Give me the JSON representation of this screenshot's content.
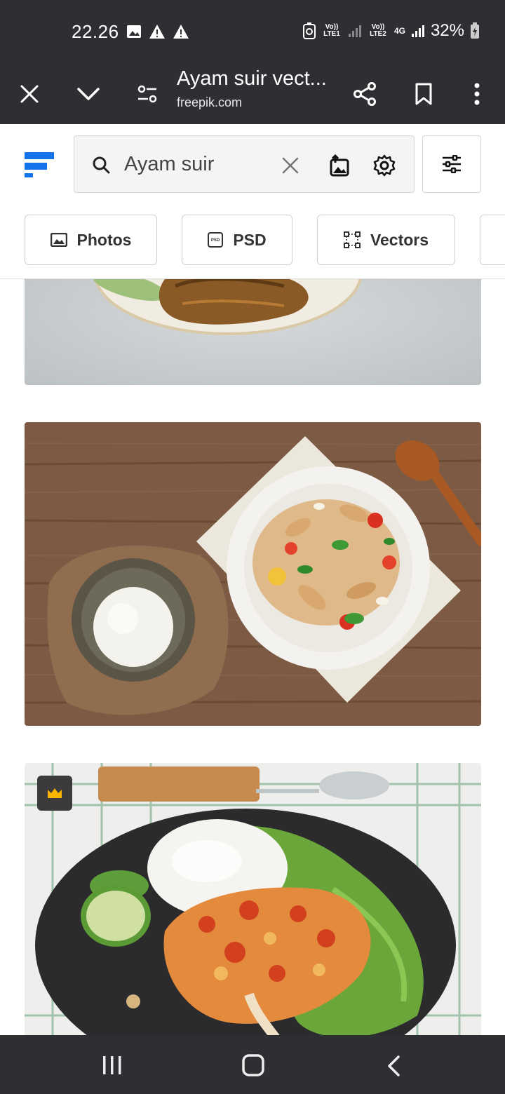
{
  "status_bar": {
    "time": "22.26",
    "network1": "Vo)) LTE1",
    "network2": "Vo)) LTE2",
    "network_type": "4G",
    "battery": "32%"
  },
  "browser": {
    "page_title": "Ayam suir vect...",
    "url": "freepik.com"
  },
  "search": {
    "query": "Ayam suir"
  },
  "filter_chips": [
    {
      "label": "Photos",
      "icon": "photo-icon"
    },
    {
      "label": "PSD",
      "icon": "psd-icon"
    },
    {
      "label": "Vectors",
      "icon": "vectors-icon"
    }
  ],
  "results": [
    {
      "description": "grilled chicken plate",
      "premium": false
    },
    {
      "description": "chicken cashew stir fry with rice",
      "premium": false
    },
    {
      "description": "ayam geprek on slate plate",
      "premium": true
    }
  ],
  "colors": {
    "chrome_bg": "#2d2f33",
    "brand_blue": "#1273eb",
    "premium_badge": "#3b3b3b",
    "crown": "#f7b500"
  }
}
